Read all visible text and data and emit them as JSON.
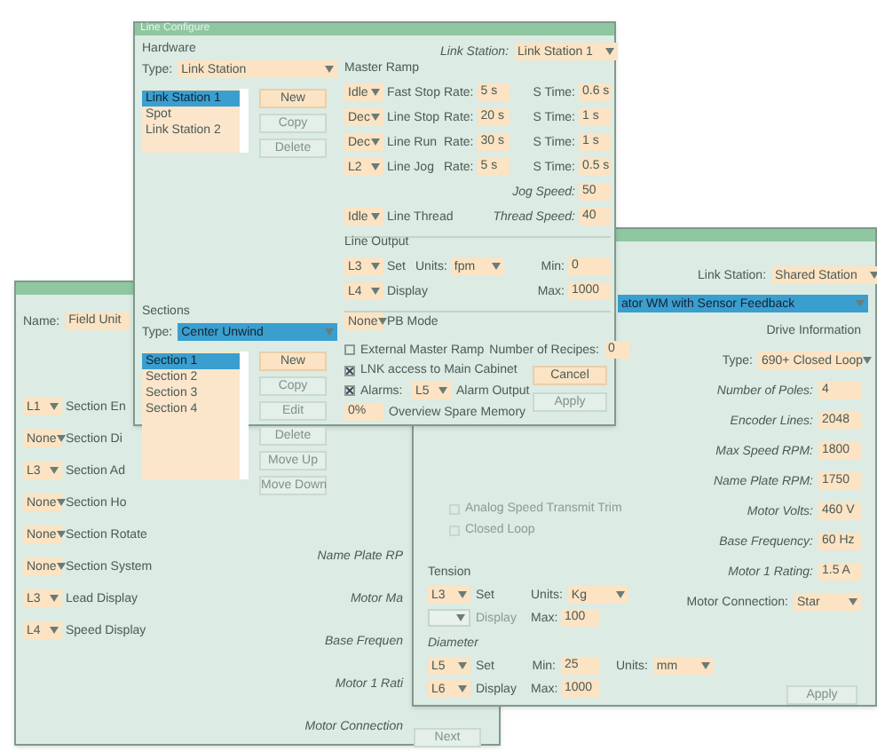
{
  "line_window": {
    "title": "Line Configure",
    "hardware": {
      "heading": "Hardware",
      "type_label": "Type:",
      "type_value": "Link Station",
      "items": [
        {
          "label": "Link Station 1",
          "selected": true
        },
        {
          "label": "Spot",
          "selected": false
        },
        {
          "label": "Link Station 2",
          "selected": false
        }
      ],
      "buttons": [
        {
          "label": "New",
          "disabled": false
        },
        {
          "label": "Copy",
          "disabled": true
        },
        {
          "label": "Delete",
          "disabled": true
        }
      ]
    },
    "sections": {
      "heading": "Sections",
      "type_label": "Type:",
      "type_value": "Center Unwind",
      "items": [
        {
          "label": "Section 1",
          "selected": true
        },
        {
          "label": "Section 2",
          "selected": false
        },
        {
          "label": "Section 3",
          "selected": false
        },
        {
          "label": "Section 4",
          "selected": false
        }
      ],
      "buttons": [
        {
          "label": "New",
          "disabled": false
        },
        {
          "label": "Copy",
          "disabled": true
        },
        {
          "label": "Edit",
          "disabled": true
        },
        {
          "label": "Delete",
          "disabled": true
        },
        {
          "label": "Move Up",
          "disabled": true
        },
        {
          "label": "Move Down",
          "disabled": true
        }
      ]
    },
    "link_station": {
      "label": "Link Station:",
      "value": "Link Station 1"
    },
    "master_ramp": {
      "heading": "Master Ramp",
      "rows": [
        {
          "input": "Idle",
          "label": "Fast Stop",
          "rate_label": "Rate:",
          "rate": "5 s",
          "stime_label": "S Time:",
          "stime": "0.6 s"
        },
        {
          "input": "Dec",
          "label": "Line Stop",
          "rate_label": "Rate:",
          "rate": "20 s",
          "stime_label": "S Time:",
          "stime": "1 s"
        },
        {
          "input": "Dec",
          "label": "Line Run",
          "rate_label": "Rate:",
          "rate": "30 s",
          "stime_label": "S Time:",
          "stime": "1 s"
        },
        {
          "input": "L2",
          "label": "Line Jog",
          "rate_label": "Rate:",
          "rate": "5 s",
          "stime_label": "S Time:",
          "stime": "0.5 s"
        }
      ],
      "jog_label": "Jog Speed:",
      "jog_value": "50",
      "thread_input": "Idle",
      "thread_label": "Line Thread",
      "thread_speed_label": "Thread Speed:",
      "thread_speed": "40"
    },
    "line_output": {
      "heading": "Line Output",
      "set_input": "L3",
      "set_label": "Set",
      "units_label": "Units:",
      "units": "fpm",
      "min_label": "Min:",
      "min": "0",
      "display_input": "L4",
      "display_label": "Display",
      "max_label": "Max:",
      "max": "1000"
    },
    "pb": {
      "input": "None",
      "label": "PB Mode"
    },
    "external_ramp": {
      "label": "External Master Ramp",
      "checked": false
    },
    "recipes": {
      "label": "Number of Recipes:",
      "value": "0"
    },
    "lnk_access": {
      "label": "LNK access to Main Cabinet",
      "checked": true
    },
    "alarms": {
      "label": "Alarms:",
      "checked": true,
      "input": "L5",
      "output_label": "Alarm Output"
    },
    "memory": {
      "value": "0%",
      "label": "Overview Spare Memory"
    },
    "buttons": [
      {
        "label": "Cancel",
        "disabled": false
      },
      {
        "label": "Apply",
        "disabled": true
      }
    ]
  },
  "section_window": {
    "name_label": "Name:",
    "name_value": "Field Unit",
    "rows": [
      {
        "input": "L1",
        "label": "Section En"
      },
      {
        "input": "None",
        "label": "Section Di"
      },
      {
        "input": "L3",
        "label": "Section Ad"
      },
      {
        "input": "None",
        "label": "Section Ho"
      },
      {
        "input": "None",
        "label": "Section Rotate"
      },
      {
        "input": "None",
        "label": "Section System"
      },
      {
        "input": "L3",
        "label": "Lead Display"
      },
      {
        "input": "L4",
        "label": "Speed Display"
      }
    ],
    "drive_labels": [
      "Name Plate RP",
      "Motor Ma",
      "Base Frequen",
      "Motor 1 Rati",
      "Motor Connection"
    ],
    "button": {
      "label": "Next",
      "disabled": true
    }
  },
  "drive_window": {
    "link_station": {
      "label": "Link Station:",
      "value": "Shared Station"
    },
    "mode_value": "ator WM with Sensor Feedback",
    "drive_info": {
      "heading": "Drive Information",
      "type_label": "Type:",
      "type_value": "690+ Closed Loop",
      "fields": [
        {
          "label": "Number of Poles:",
          "value": "4"
        },
        {
          "label": "Encoder Lines:",
          "value": "2048"
        },
        {
          "label": "Max Speed RPM:",
          "value": "1800"
        },
        {
          "label": "Name Plate RPM:",
          "value": "1750"
        },
        {
          "label": "Motor Volts:",
          "value": "460 V"
        },
        {
          "label": "Base Frequency:",
          "value": "60 Hz"
        },
        {
          "label": "Motor 1 Rating:",
          "value": "1.5 A"
        }
      ],
      "connection_label": "Motor Connection:",
      "connection_value": "Star"
    },
    "options": [
      {
        "label": "Analog Speed Transmit Trim",
        "checked": false,
        "disabled": true
      },
      {
        "label": "Closed Loop",
        "checked": false,
        "disabled": true
      }
    ],
    "tension": {
      "heading": "Tension",
      "set_input": "L3",
      "set_label": "Set",
      "units_label": "Units:",
      "units": "Kg",
      "display_label": "Display",
      "display_disabled": true,
      "max_label": "Max:",
      "max": "100"
    },
    "diameter": {
      "heading": "Diameter",
      "set_input": "L5",
      "set_label": "Set",
      "min_label": "Min:",
      "min": "25",
      "units_label": "Units:",
      "units": "mm",
      "display_input": "L6",
      "display_label": "Display",
      "max_label": "Max:",
      "max": "1000"
    },
    "button": {
      "label": "Apply",
      "disabled": true
    }
  }
}
